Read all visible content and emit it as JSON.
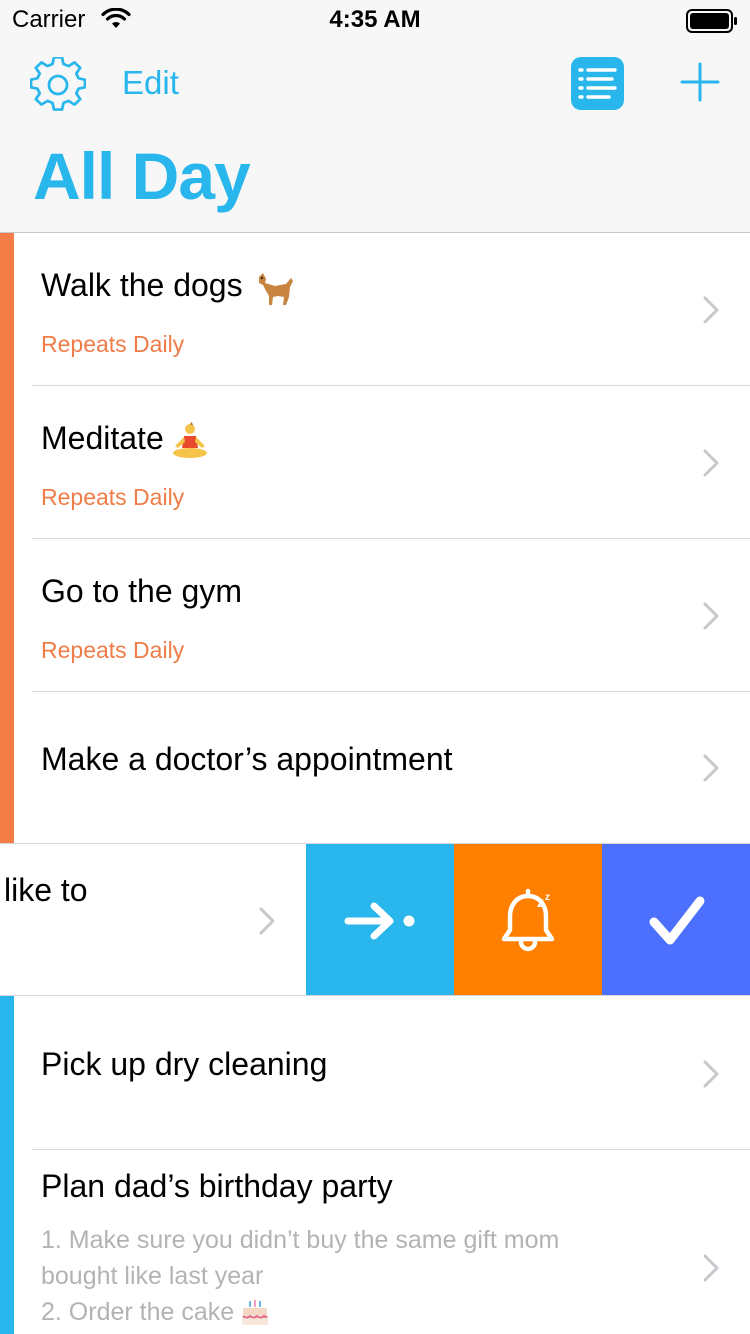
{
  "status_bar": {
    "carrier": "Carrier",
    "time": "4:35 AM"
  },
  "nav": {
    "edit_label": "Edit",
    "title": "All Day"
  },
  "colors": {
    "accent": "#29b6ec",
    "orange_stripe": "#f47c47",
    "blue_stripe": "#29b6ec",
    "subtitle": "#f07c47",
    "move_action": "#29b6ec",
    "snooze_action": "#ff8000",
    "complete_action": "#4c6ffe"
  },
  "tasks": [
    {
      "title": "Walk the dogs",
      "subtitle": "Repeats Daily"
    },
    {
      "title": "Meditate",
      "subtitle": "Repeats Daily"
    },
    {
      "title": "Go to the gym",
      "subtitle": "Repeats Daily"
    },
    {
      "title": "Make a doctor’s appointment"
    }
  ],
  "swiped_task": {
    "visible_title": "like to",
    "actions": [
      {
        "icon": "arrow-right-dot-icon",
        "name": "move"
      },
      {
        "icon": "bell-snooze-icon",
        "name": "snooze"
      },
      {
        "icon": "checkmark-icon",
        "name": "complete"
      }
    ]
  },
  "later_tasks": [
    {
      "title": "Pick up dry cleaning"
    },
    {
      "title": "Plan dad’s birthday party",
      "note_line1": "1. Make sure you didn’t buy the same gift mom",
      "note_line2": "bought like last year",
      "note_line3": "2. Order the cake"
    }
  ]
}
